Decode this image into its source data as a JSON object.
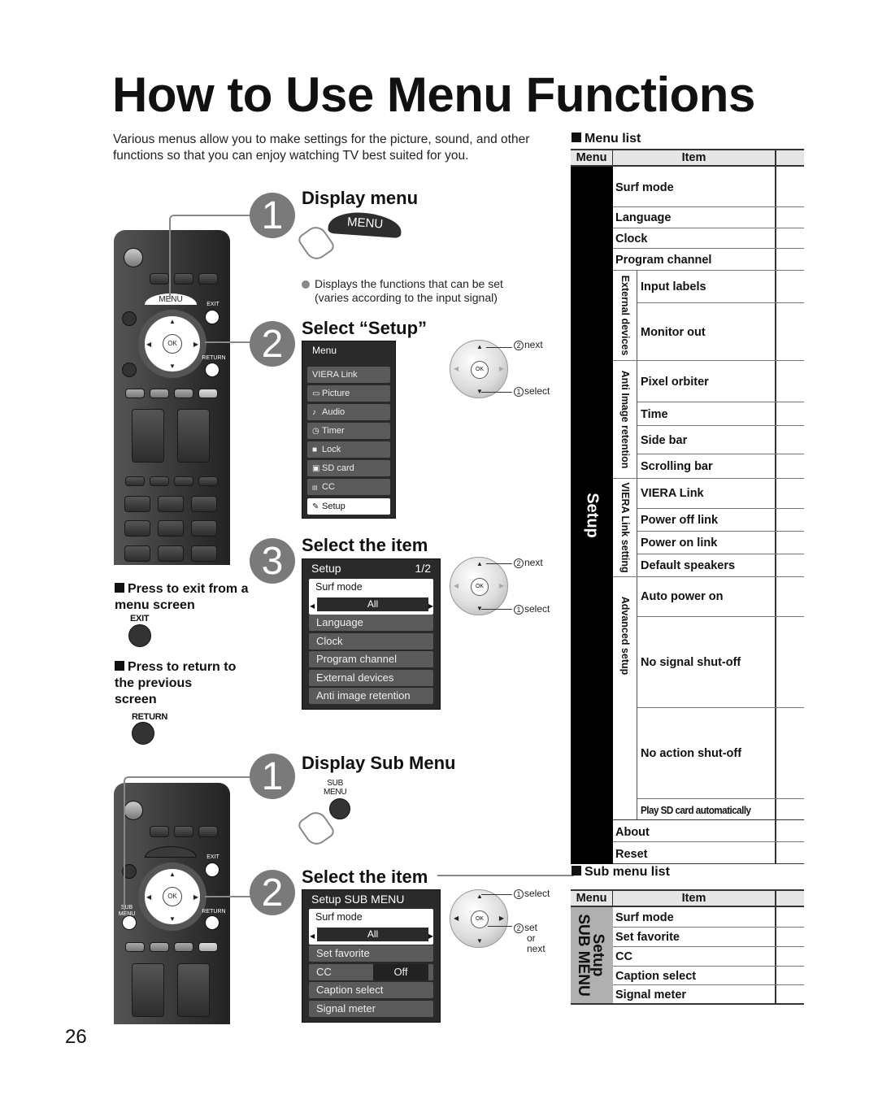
{
  "page": {
    "title": "How to Use Menu Functions",
    "intro": "Various menus allow you to make settings for the picture, sound, and other functions so that you can enjoy watching TV best suited for you.",
    "page_number": "26"
  },
  "menu_section": {
    "steps": [
      {
        "number": "1",
        "heading": "Display menu",
        "button_label": "MENU",
        "note": "Displays the functions that can be set (varies according to the input signal)"
      },
      {
        "number": "2",
        "heading": "Select “Setup”"
      },
      {
        "number": "3",
        "heading": "Select the item"
      }
    ],
    "main_menu": {
      "title": "Menu",
      "items": [
        {
          "label": "VIERA Link",
          "icon": ""
        },
        {
          "label": "Picture",
          "icon": "picture-icon"
        },
        {
          "label": "Audio",
          "icon": "music-note-icon"
        },
        {
          "label": "Timer",
          "icon": "clock-icon"
        },
        {
          "label": "Lock",
          "icon": "lock-icon"
        },
        {
          "label": "SD card",
          "icon": "sd-card-icon"
        },
        {
          "label": "CC",
          "icon": "cc-icon"
        },
        {
          "label": "Setup",
          "icon": "wrench-icon",
          "selected": true
        }
      ]
    },
    "setup_menu": {
      "title": "Setup",
      "page": "1/2",
      "selected_item": {
        "label": "Surf mode",
        "value": "All"
      },
      "items": [
        "Language",
        "Clock",
        "Program channel",
        "External devices",
        "Anti image retention"
      ]
    },
    "dpad_annotations": {
      "next": "next",
      "select": "select",
      "num_next": "2",
      "num_select": "1"
    }
  },
  "exit_note": {
    "text": "Press to exit from a menu screen",
    "button_label": "EXIT"
  },
  "return_note": {
    "text": "Press to return to the previous screen",
    "button_label": "RETURN"
  },
  "remote": {
    "menu_label": "MENU",
    "exit_label": "EXIT",
    "return_label": "RETURN",
    "ok_label": "OK",
    "sub_menu_label": "SUB MENU"
  },
  "submenu_section": {
    "steps": [
      {
        "number": "1",
        "heading": "Display Sub Menu",
        "button_label_line1": "SUB",
        "button_label_line2": "MENU"
      },
      {
        "number": "2",
        "heading": "Select the item"
      }
    ],
    "panel": {
      "title": "Setup SUB MENU",
      "selected_item": {
        "label": "Surf mode",
        "value": "All"
      },
      "items": [
        {
          "label": "Set favorite"
        },
        {
          "label": "CC",
          "value": "Off"
        },
        {
          "label": "Caption select"
        },
        {
          "label": "Signal meter"
        }
      ]
    },
    "dpad_annotations": {
      "select": "select",
      "set": "set",
      "or": "or",
      "next": "next",
      "num_select": "1",
      "num_set": "2"
    }
  },
  "menu_list": {
    "title": "Menu list",
    "header": {
      "menu": "Menu",
      "item": "Item"
    },
    "menu_name": "Setup",
    "top_items": [
      "Surf mode",
      "Language",
      "Clock",
      "Program channel"
    ],
    "groups": [
      {
        "name": "External devices",
        "items": [
          "Input labels",
          "Monitor out"
        ]
      },
      {
        "name": "Anti Image retention",
        "items": [
          "Pixel orbiter",
          "Time",
          "Side bar",
          "Scrolling bar"
        ]
      },
      {
        "name": "VIERA Link setting",
        "items": [
          "VIERA Link",
          "Power off link",
          "Power on link",
          "Default speakers"
        ]
      },
      {
        "name": "Advanced setup",
        "items": [
          "Auto power on",
          "No signal shut-off",
          "No action shut-off",
          "Play SD card automatically"
        ]
      }
    ],
    "bottom_items": [
      "About",
      "Reset"
    ]
  },
  "sub_menu_list": {
    "title": "Sub menu list",
    "header": {
      "menu": "Menu",
      "item": "Item"
    },
    "menu_name_line1": "Setup",
    "menu_name_line2": "SUB MENU",
    "items": [
      "Surf mode",
      "Set favorite",
      "CC",
      "Caption select",
      "Signal meter"
    ]
  }
}
